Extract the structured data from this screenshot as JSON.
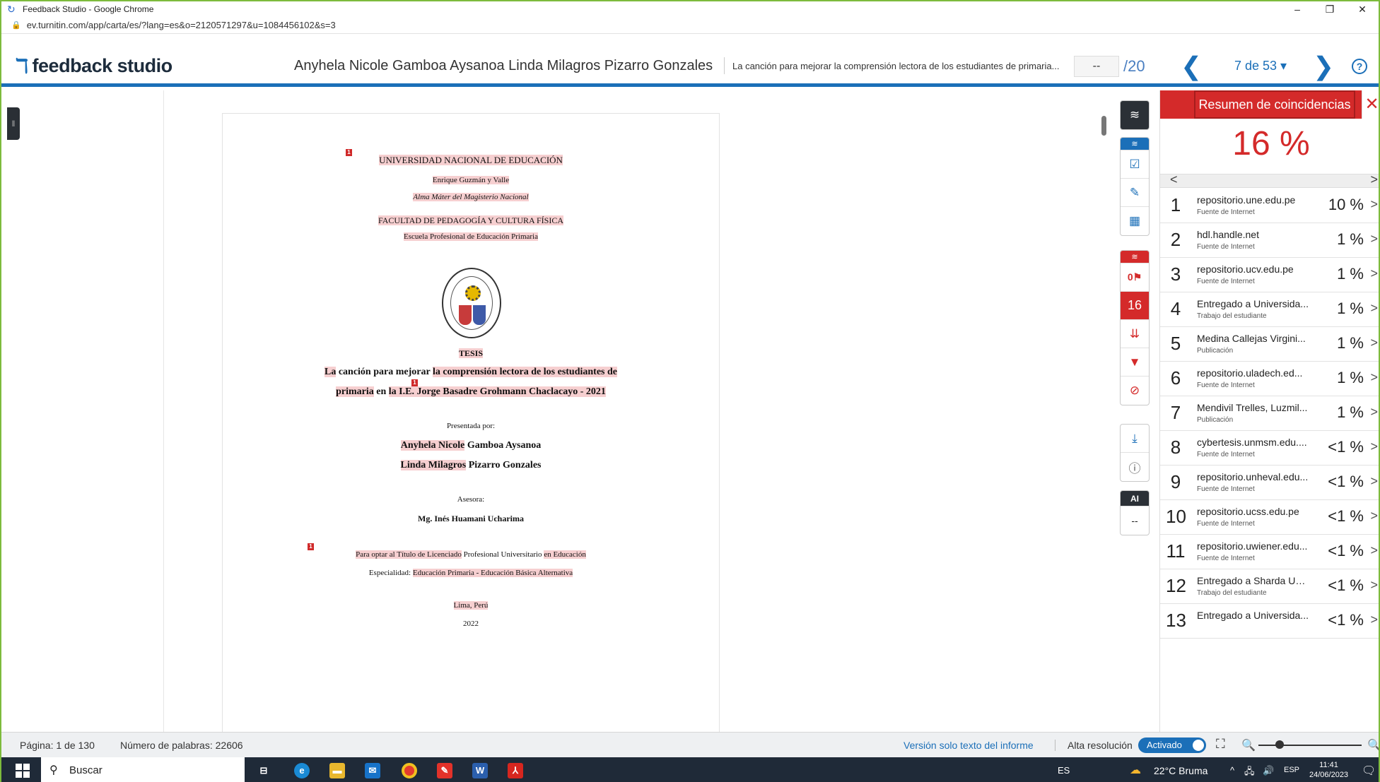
{
  "browser": {
    "window_title": "Feedback Studio - Google Chrome",
    "url": "ev.turnitin.com/app/carta/es/?lang=es&o=2120571297&u=1084456102&s=3",
    "controls": {
      "minimize": "–",
      "restore": "❐",
      "close": "✕"
    }
  },
  "header": {
    "logo": "feedback studio",
    "authors": "Anyhela Nicole Gamboa Aysanoa Linda Milagros Pizarro Gonzales",
    "paper_title": "La canción para mejorar la comprensión lectora de los estudiantes de primaria...",
    "grade": "--",
    "grade_total": "/20",
    "nav_prev": "❮",
    "nav_count": "7 de 53 ▾",
    "nav_next": "❯",
    "help": "?"
  },
  "document": {
    "lines": {
      "university": "UNIVERSIDAD NACIONAL DE EDUCACIÓN",
      "name": "Enrique Guzmán y Valle",
      "motto": "Alma Máter del Magisterio Nacional",
      "faculty": "FACULTAD DE PEDAGOGÍA Y CULTURA FÍSICA",
      "school": "Escuela Profesional de Educación Primaria",
      "tesis": "TESIS",
      "title1a": "La",
      "title1b": " canción para mejorar ",
      "title1c": "la comprensión lectora de los estudiantes de",
      "title2a": "primaria",
      "title2b": " en ",
      "title2c": "la I.E. Jorge Basadre Grohmann Chaclacayo - 2021",
      "presentada": "Presentada por:",
      "author1a": "Anyhela Nicole",
      "author1b": " Gamboa Aysanoa",
      "author2a": "Linda Milagros",
      "author2b": " Pizarro Gonzales",
      "asesora": "Asesora:",
      "advisor": "Mg. Inés Huamani Ucharima",
      "optar_a": "Para optar al Título de Licenciado",
      "optar_b": " Profesional Universitario ",
      "optar_c": "en Educación",
      "esp_a": "Especialidad: ",
      "esp_b": "Educación Primaria - Educación Básica Alternativa",
      "city": "Lima, Perú",
      "year": "2022"
    },
    "marker": "1"
  },
  "toolbar": {
    "layers": "≋",
    "blue_layer": "≋",
    "check": "☑",
    "edit": "✎",
    "grid": "▦",
    "red_layer": "≋",
    "flag_count": "0⚑",
    "similarity": "16",
    "sort": "⇊",
    "filter": "▼",
    "exclude": "⊘",
    "download": "⤓",
    "info": "ⓘ",
    "ai_label": "AI",
    "ai_value": "--"
  },
  "match_panel": {
    "title": "Resumen de coincidencias",
    "close": "✕",
    "percent": "16 %",
    "prev": "<",
    "next": ">",
    "matches": [
      {
        "n": "1",
        "source": "repositorio.une.edu.pe",
        "type": "Fuente de Internet",
        "pct": "10 %"
      },
      {
        "n": "2",
        "source": "hdl.handle.net",
        "type": "Fuente de Internet",
        "pct": "1 %"
      },
      {
        "n": "3",
        "source": "repositorio.ucv.edu.pe",
        "type": "Fuente de Internet",
        "pct": "1 %"
      },
      {
        "n": "4",
        "source": "Entregado a Universida...",
        "type": "Trabajo del estudiante",
        "pct": "1 %"
      },
      {
        "n": "5",
        "source": "Medina Callejas Virgini...",
        "type": "Publicación",
        "pct": "1 %"
      },
      {
        "n": "6",
        "source": "repositorio.uladech.ed...",
        "type": "Fuente de Internet",
        "pct": "1 %"
      },
      {
        "n": "7",
        "source": "Mendivil Trelles, Luzmil...",
        "type": "Publicación",
        "pct": "1 %"
      },
      {
        "n": "8",
        "source": "cybertesis.unmsm.edu....",
        "type": "Fuente de Internet",
        "pct": "<1 %"
      },
      {
        "n": "9",
        "source": "repositorio.unheval.edu...",
        "type": "Fuente de Internet",
        "pct": "<1 %"
      },
      {
        "n": "10",
        "source": "repositorio.ucss.edu.pe",
        "type": "Fuente de Internet",
        "pct": "<1 %"
      },
      {
        "n": "11",
        "source": "repositorio.uwiener.edu...",
        "type": "Fuente de Internet",
        "pct": "<1 %"
      },
      {
        "n": "12",
        "source": "Entregado a Sharda Uni...",
        "type": "Trabajo del estudiante",
        "pct": "<1 %"
      },
      {
        "n": "13",
        "source": "Entregado a Universida...",
        "type": "",
        "pct": "<1 %"
      }
    ]
  },
  "statusbar": {
    "page": "Página: 1 de 130",
    "words": "Número de palabras: 22606",
    "text_version": "Versión solo texto del informe",
    "hires_label": "Alta resolución",
    "hires_state": "Activado"
  },
  "taskbar": {
    "search": "Buscar",
    "lang": "ES",
    "weather": "22°C  Bruma",
    "input_lang": "ESP",
    "time": "11:41",
    "date": "24/06/2023"
  }
}
